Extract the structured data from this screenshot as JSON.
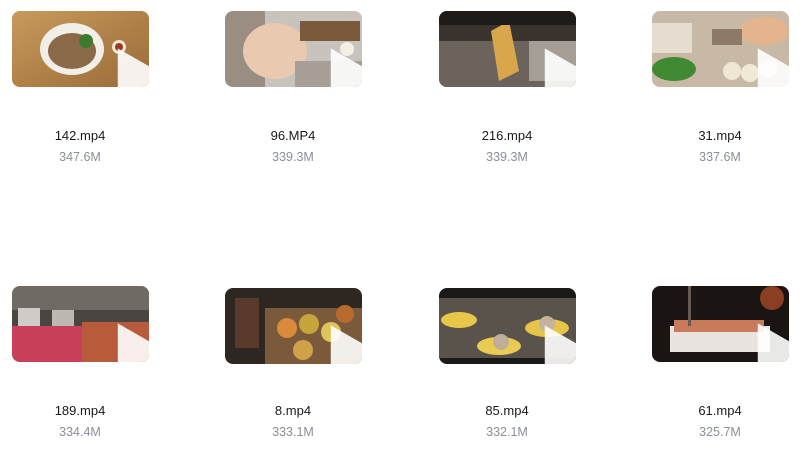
{
  "videos": [
    {
      "name": "142.mp4",
      "size": "347.6M"
    },
    {
      "name": "96.MP4",
      "size": "339.3M"
    },
    {
      "name": "216.mp4",
      "size": "339.3M"
    },
    {
      "name": "31.mp4",
      "size": "337.6M"
    },
    {
      "name": "189.mp4",
      "size": "334.4M"
    },
    {
      "name": "8.mp4",
      "size": "333.1M"
    },
    {
      "name": "85.mp4",
      "size": "332.1M"
    },
    {
      "name": "61.mp4",
      "size": "325.7M"
    }
  ],
  "icons": {
    "play": "play-icon"
  }
}
